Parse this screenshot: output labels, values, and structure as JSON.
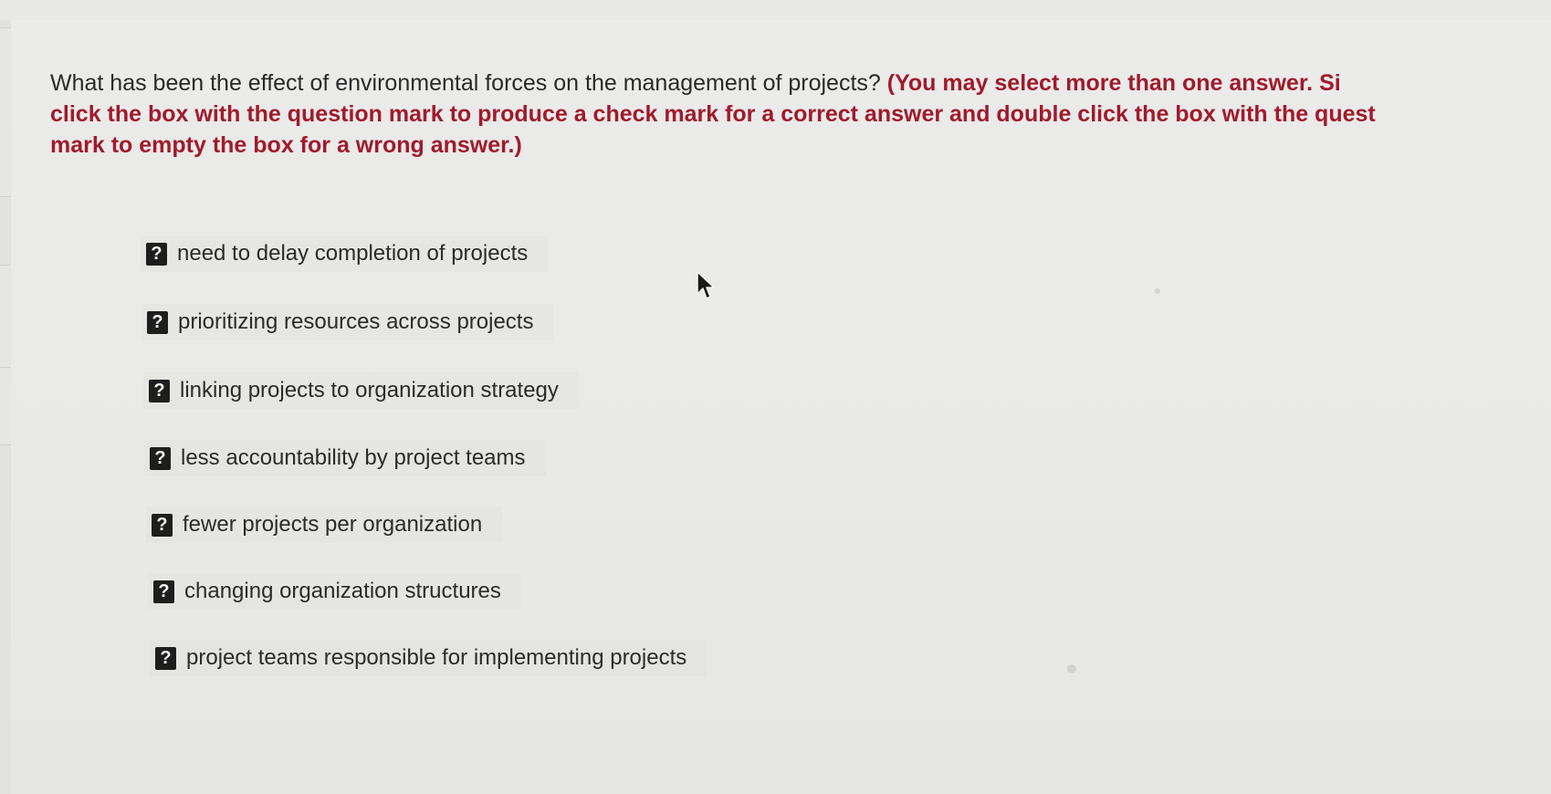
{
  "question": {
    "prompt": "What has been the effect of environmental forces on the management of projects?",
    "instruction_line1": "(You may select more than one answer. Si",
    "instruction_line2": "click the box with the question mark to produce a check mark for a correct answer and double click the box with the quest",
    "instruction_line3": "mark to empty the box for a wrong answer.)"
  },
  "checkbox_symbol": "?",
  "options": [
    {
      "label": "need to delay completion of projects"
    },
    {
      "label": "prioritizing resources across projects"
    },
    {
      "label": "linking projects to organization strategy"
    },
    {
      "label": "less accountability by project teams"
    },
    {
      "label": "fewer projects per organization"
    },
    {
      "label": "changing organization structures"
    },
    {
      "label": "project teams responsible for implementing projects"
    }
  ],
  "colors": {
    "background": "#e9e9e7",
    "question_text": "#2a2a2a",
    "instruction_text": "#a01a2c",
    "checkbox": "#1e1e1e"
  },
  "icons": {
    "cursor": "mouse-pointer-icon",
    "checkbox": "question-mark-box-icon"
  }
}
